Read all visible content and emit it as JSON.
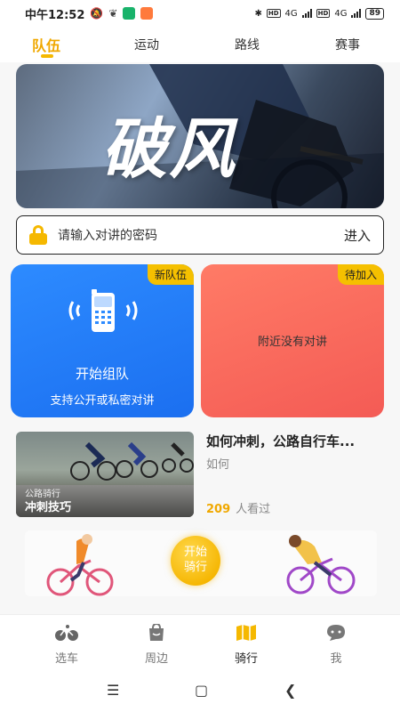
{
  "status_bar": {
    "time": "中午12:52",
    "battery": "89",
    "network_label": "4G"
  },
  "top_tabs": [
    {
      "label": "队伍",
      "active": true
    },
    {
      "label": "运动",
      "active": false
    },
    {
      "label": "路线",
      "active": false
    },
    {
      "label": "赛事",
      "active": false
    }
  ],
  "banner": {
    "title": "破风"
  },
  "password_bar": {
    "placeholder": "请输入对讲的密码",
    "enter_label": "进入"
  },
  "cards": {
    "new_team": {
      "tag": "新队伍",
      "title": "开始组队",
      "subtitle": "支持公开或私密对讲"
    },
    "pending": {
      "tag": "待加入",
      "title": "附近没有对讲"
    }
  },
  "article": {
    "thumb_category": "公路骑行",
    "thumb_title": "冲刺技巧",
    "title": "如何冲刺，公路自行车...",
    "subtitle": "如何",
    "views": "209",
    "views_suffix": "人看过"
  },
  "ride_banner": {
    "button_line1": "开始",
    "button_line2": "骑行"
  },
  "bottom_nav": [
    {
      "label": "选车",
      "icon": "bike-icon",
      "active": false
    },
    {
      "label": "周边",
      "icon": "shopping-bag-icon",
      "active": false
    },
    {
      "label": "骑行",
      "icon": "map-icon",
      "active": true
    },
    {
      "label": "我",
      "icon": "profile-chat-icon",
      "active": false
    }
  ],
  "colors": {
    "accent": "#f5b800",
    "blue_card": "#2d8bff",
    "red_card": "#f45b55"
  }
}
